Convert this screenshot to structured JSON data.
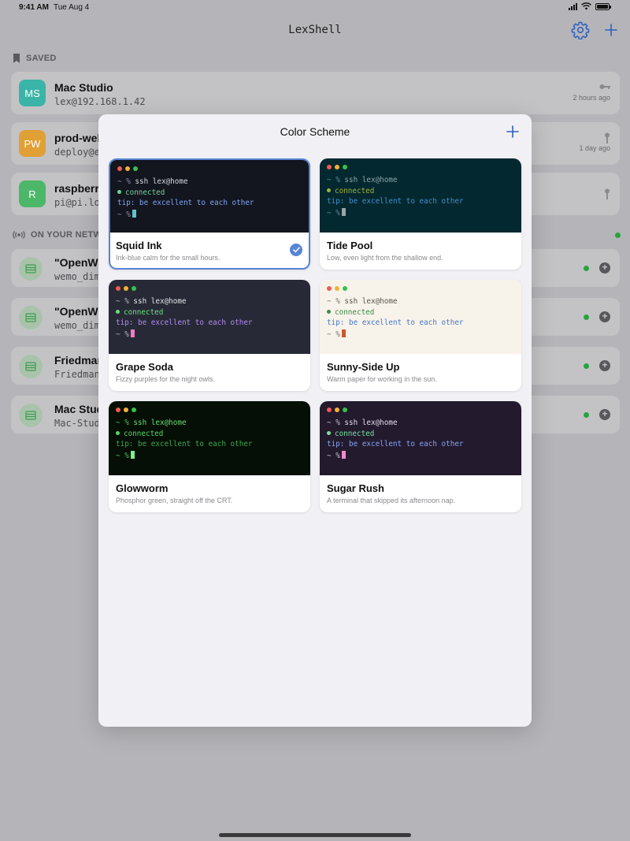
{
  "status_bar": {
    "time": "9:41 AM",
    "date": "Tue Aug 4"
  },
  "nav": {
    "title": "LexShell",
    "settings_icon": "gear-icon",
    "add_icon": "plus-icon",
    "accent": "#2c5fbe"
  },
  "saved_section": {
    "header": "SAVED",
    "items": [
      {
        "initials": "MS",
        "title": "Mac Studio",
        "subtitle": "lex@192.168.1.42",
        "meta": "2 hours ago",
        "color": "#3ab4a6",
        "icon": "key-icon"
      },
      {
        "initials": "PW",
        "title": "prod-web",
        "subtitle": "deploy@e",
        "meta": "1 day ago",
        "color": "#e0a035",
        "icon": "key-icon"
      },
      {
        "initials": "R",
        "title": "raspberry",
        "subtitle": "pi@pi.lo",
        "meta": "",
        "color": "#4cb768",
        "icon": "key-icon"
      }
    ]
  },
  "network_section": {
    "header": "ON YOUR NETW",
    "items": [
      {
        "title": "\"OpenWr",
        "subtitle": "wemo_dim"
      },
      {
        "title": "\"OpenWr",
        "subtitle": "wemo_dim"
      },
      {
        "title": "Friedman",
        "subtitle": "Friedman"
      },
      {
        "title": "Mac Stud",
        "subtitle": "Mac-Stud"
      }
    ]
  },
  "modal": {
    "title": "Color Scheme",
    "add_icon": "plus-icon",
    "preview_lines": {
      "prompt": "~ %",
      "command": "ssh lex@home",
      "status": "connected",
      "tip": "tip: be excellent to each other"
    },
    "schemes": [
      {
        "name": "Squid Ink",
        "description": "Ink-blue calm for the small hours.",
        "selected": true,
        "bg": "#13151f",
        "fg": "#d7d9e0",
        "prompt": "#8a8fa6",
        "green": "#6ed49a",
        "tip": "#7fa6f0",
        "cursor": "#5ec4c9"
      },
      {
        "name": "Tide Pool",
        "description": "Low, even light from the shallow end.",
        "selected": false,
        "bg": "#04282f",
        "fg": "#8aa6ab",
        "prompt": "#5c8a91",
        "green": "#9bb43a",
        "tip": "#3f8fd0",
        "cursor": "#9aa4a6"
      },
      {
        "name": "Grape Soda",
        "description": "Fizzy purples for the night owls.",
        "selected": false,
        "bg": "#272a36",
        "fg": "#e4e4ea",
        "prompt": "#b6b6c2",
        "green": "#69e07e",
        "tip": "#b38af2",
        "cursor": "#f07cc4"
      },
      {
        "name": "Sunny-Side Up",
        "description": "Warm paper for working in the sun.",
        "selected": false,
        "bg": "#f8f3ea",
        "fg": "#58544c",
        "prompt": "#7a7468",
        "green": "#3a8a4a",
        "tip": "#4677c9",
        "cursor": "#c9582e"
      },
      {
        "name": "Glowworm",
        "description": "Phosphor green, straight off the CRT.",
        "selected": false,
        "bg": "#050f05",
        "fg": "#68df75",
        "prompt": "#4fbf5c",
        "green": "#55d765",
        "tip": "#3ea84b",
        "cursor": "#7cf08a"
      },
      {
        "name": "Sugar Rush",
        "description": "A terminal that skipped its afternoon nap.",
        "selected": false,
        "bg": "#231a2e",
        "fg": "#e4dcea",
        "prompt": "#c9c0d3",
        "green": "#76e3a0",
        "tip": "#86a4f4",
        "cursor": "#f58ac9"
      }
    ]
  }
}
